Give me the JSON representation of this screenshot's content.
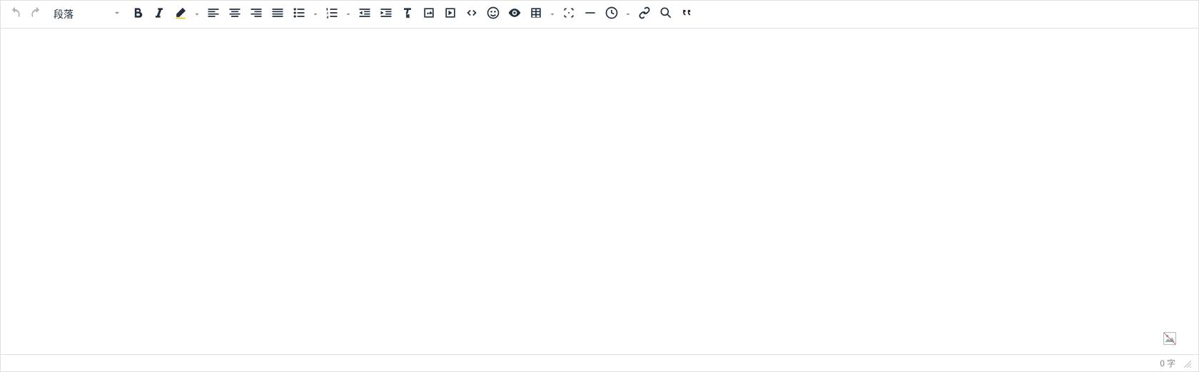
{
  "toolbar": {
    "format_label": "段落"
  },
  "status": {
    "word_count": "0 字"
  },
  "icons": {
    "undo": "undo",
    "redo": "redo"
  }
}
